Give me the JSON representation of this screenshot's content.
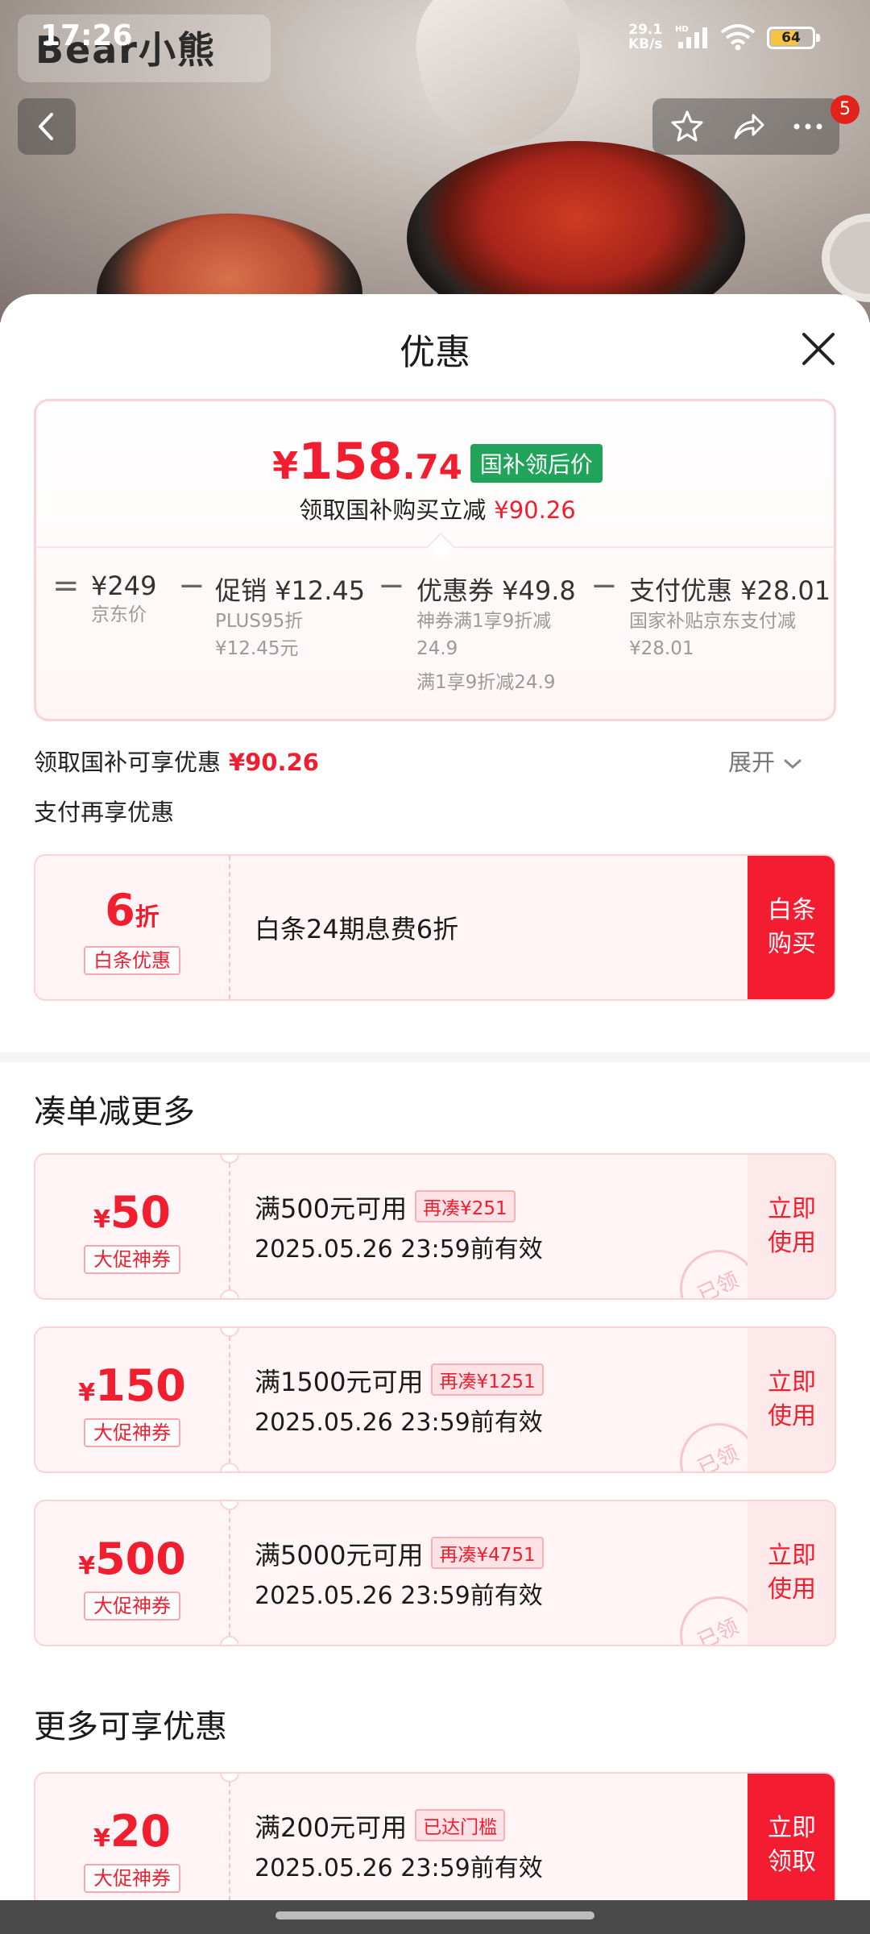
{
  "status_bar": {
    "time": "17:26",
    "net_speed_value": "29.1",
    "net_speed_unit": "KB/s",
    "network_tag": "HD",
    "battery": "64"
  },
  "header": {
    "brand_logo": "Bear小熊",
    "notification_count": "5"
  },
  "sheet": {
    "title": "优惠",
    "price": {
      "symbol": "¥",
      "integer": "158",
      "decimal": ".74",
      "tag": "国补领后价",
      "subtitle": "领取国补购买立减",
      "saving": "¥90.26"
    },
    "breakdown": [
      {
        "op": "=",
        "main": "¥249",
        "sub1": "京东价",
        "sub2": "",
        "sub3": ""
      },
      {
        "op": "−",
        "main": "促销 ¥12.45",
        "sub1": "PLUS95折",
        "sub2": "¥12.45元",
        "sub3": ""
      },
      {
        "op": "−",
        "main": "优惠券 ¥49.8",
        "sub1": "神券满1享9折减",
        "sub2": "24.9",
        "sub3": "满1享9折减24.9"
      },
      {
        "op": "−",
        "main": "支付优惠 ¥28.01",
        "sub1": "国家补贴京东支付减",
        "sub2": "¥28.01",
        "sub3": ""
      }
    ],
    "subsidy_row": {
      "label": "领取国补可享优惠",
      "value": "¥90.26",
      "expand": "展开"
    },
    "pay_section_title": "支付再享优惠",
    "baitiao": {
      "amount": "6",
      "unit": "折",
      "tag": "白条优惠",
      "title": "白条24期息费6折",
      "button": "白条\n购买"
    },
    "more_section_title": "凑单减更多",
    "coupons": [
      {
        "symbol": "¥",
        "amount": "50",
        "tag": "大促神券",
        "condition": "满500元可用",
        "pill": "再凑¥251",
        "expiry": "2025.05.26 23:59前有效",
        "button": "立即\n使用",
        "stamp": "已领"
      },
      {
        "symbol": "¥",
        "amount": "150",
        "tag": "大促神券",
        "condition": "满1500元可用",
        "pill": "再凑¥1251",
        "expiry": "2025.05.26 23:59前有效",
        "button": "立即\n使用",
        "stamp": "已领"
      },
      {
        "symbol": "¥",
        "amount": "500",
        "tag": "大促神券",
        "condition": "满5000元可用",
        "pill": "再凑¥4751",
        "expiry": "2025.05.26 23:59前有效",
        "button": "立即\n使用",
        "stamp": "已领"
      }
    ],
    "extra_section_title": "更多可享优惠",
    "extra_coupon": {
      "symbol": "¥",
      "amount": "20",
      "tag": "大促神券",
      "condition": "满200元可用",
      "pill": "已达门槛",
      "expiry": "2025.05.26 23:59前有效",
      "button": "立即\n领取"
    }
  },
  "colors": {
    "accent": "#f01e2f",
    "tag_green": "#22a35b",
    "card_bg": "#fff5f6"
  }
}
